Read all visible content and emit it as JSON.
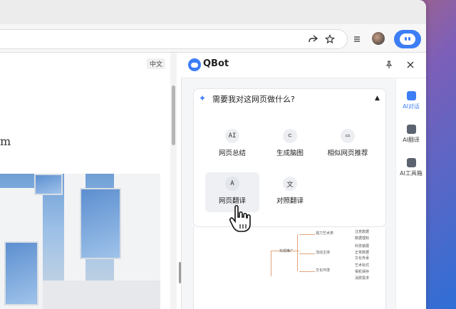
{
  "browser": {
    "toolbar_icons": [
      "share-icon",
      "star-icon",
      "menu-icon"
    ],
    "lang_tag": "中文"
  },
  "page": {
    "text_fragment": "m"
  },
  "panel": {
    "title": "QBot",
    "pin_icon": "pin-icon",
    "close_icon": "close-icon",
    "card": {
      "question": "需要我对这网页做什么?",
      "tools": [
        {
          "label": "网页总结",
          "icon": "AI"
        },
        {
          "label": "生成脑图",
          "icon": "⊂"
        },
        {
          "label": "相似网页推荐",
          "icon": "▭"
        },
        {
          "label": "网页翻译",
          "icon": "A"
        },
        {
          "label": "对照翻译",
          "icon": "文"
        }
      ]
    },
    "rail": [
      {
        "label": "AI对话",
        "active": true
      },
      {
        "label": "AI翻译",
        "active": false
      },
      {
        "label": "AI工具箱",
        "active": false
      }
    ],
    "mindmap": {
      "root": "实现推广",
      "branches": [
        "视力艺术类",
        "活动主持",
        "文化环境"
      ],
      "leaves": [
        "注意数据",
        "数据理知",
        "科技装展",
        "正常数据",
        "文化传承",
        "艺术标式",
        "相机保存",
        "消费需求"
      ]
    }
  },
  "colors": {
    "accent": "#3d7ef5",
    "mindmap_line": "#e2a47a"
  }
}
